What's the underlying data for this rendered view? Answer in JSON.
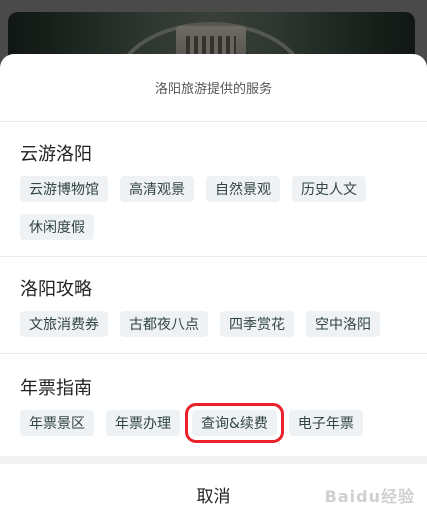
{
  "sheet": {
    "title": "洛阳旅游提供的服务",
    "cancel_label": "取消"
  },
  "sections": [
    {
      "heading": "云游洛阳",
      "chips": [
        "云游博物馆",
        "高清观景",
        "自然景观",
        "历史人文",
        "休闲度假"
      ]
    },
    {
      "heading": "洛阳攻略",
      "chips": [
        "文旅消费券",
        "古都夜八点",
        "四季赏花",
        "空中洛阳"
      ]
    },
    {
      "heading": "年票指南",
      "chips": [
        "年票景区",
        "年票办理",
        "查询&续费",
        "电子年票"
      ]
    }
  ],
  "highlight": {
    "color": "#e8212b",
    "target": "查询&续费"
  },
  "watermark": "Baidu经验"
}
